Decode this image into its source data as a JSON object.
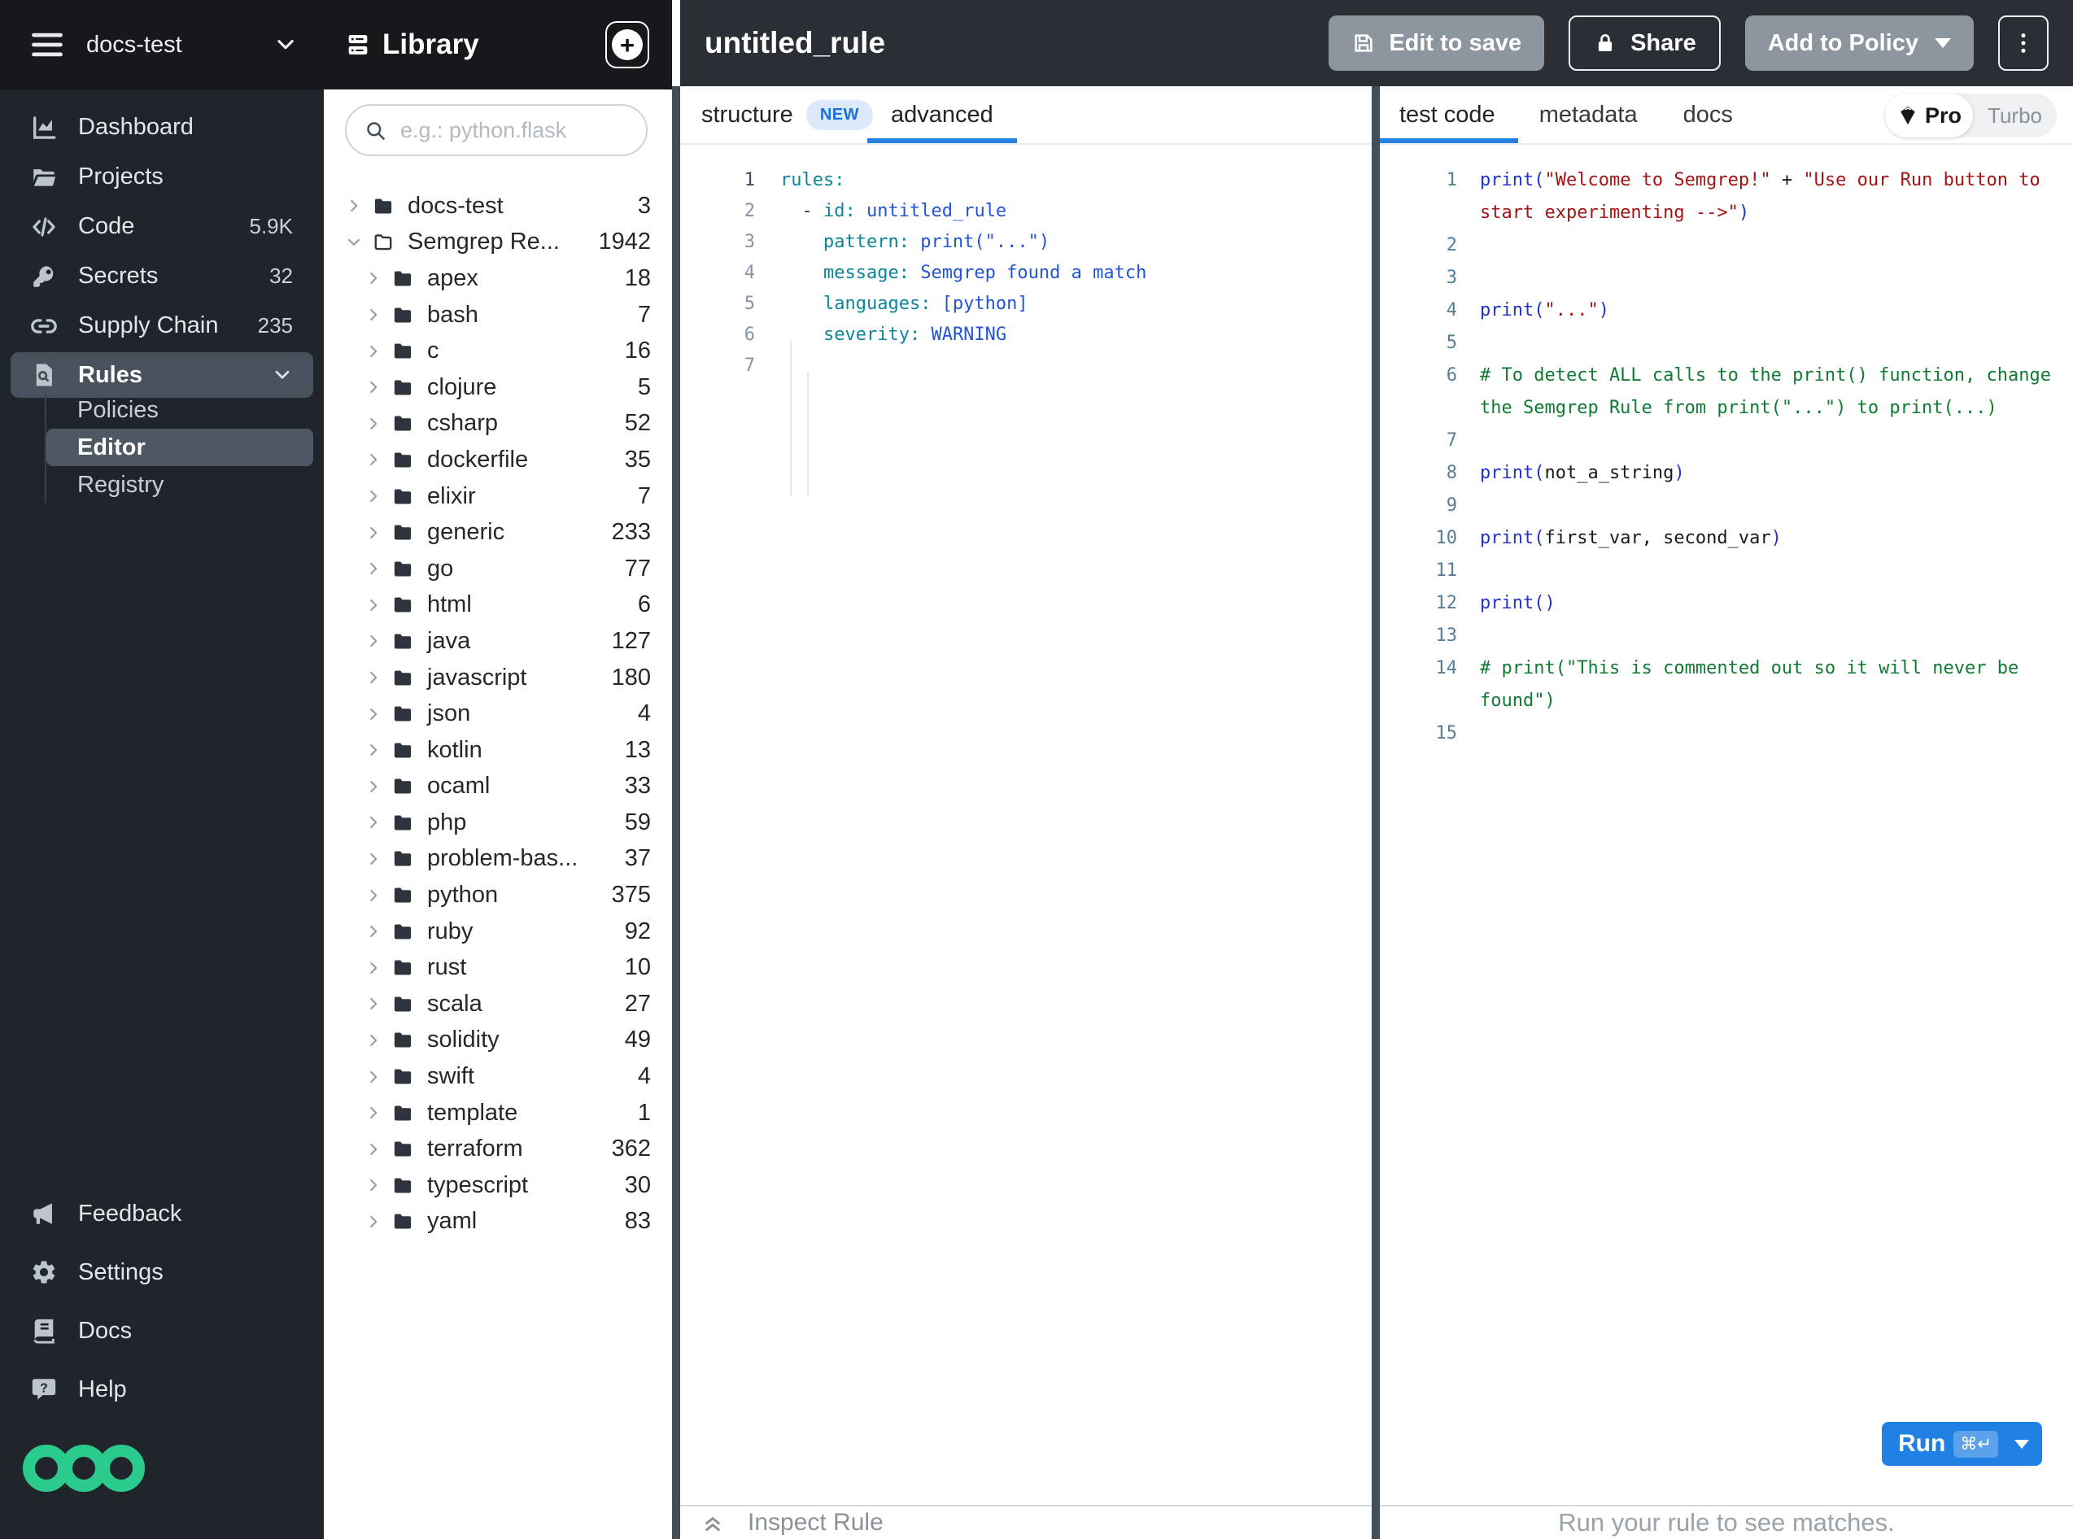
{
  "colors": {
    "brand_green": "#2bcb8e",
    "accent_blue": "#2581e2",
    "run_button_blue": "#2080e4",
    "topbar_bg": "#16181c",
    "sidebar_bg": "#20252b",
    "header_bg": "#2a2e35",
    "divider": "#424d57",
    "selected_row_bg": "#47525d",
    "new_badge_bg": "#dce9fb",
    "new_badge_text": "#1a6fde",
    "yaml_key": "#0c8599",
    "yaml_value": "#2454d6",
    "py_builtin": "#2433cc",
    "py_string": "#a31515",
    "py_comment": "#117a33"
  },
  "icons": {
    "hamburger": "menu-lines",
    "dashboard": "bar-chart",
    "projects": "open-folder",
    "code": "code-brackets-slash",
    "secrets": "key",
    "supply-chain": "chain-link",
    "rules": "document-magnifier",
    "feedback": "megaphone",
    "settings": "gear",
    "docs": "book",
    "help": "chat-question",
    "library": "collection-stack",
    "plus": "plus-circle",
    "search": "magnifier",
    "save": "floppy-disk",
    "lock": "padlock",
    "kebab": "vertical-dots",
    "chevron-down": "chevron-down",
    "chevron-right": "chevron-right",
    "double-chevron-up": "double-chevron-up",
    "pro-gem": "diamond",
    "folder-filled": "folder",
    "folder-outline": "folder-outline",
    "logo": "three-green-rings"
  },
  "topbar": {
    "org_name": "docs-test"
  },
  "sidebar": {
    "items": [
      {
        "label": "Dashboard",
        "icon": "dashboard"
      },
      {
        "label": "Projects",
        "icon": "projects"
      },
      {
        "label": "Code",
        "icon": "code",
        "badge": "5.9K"
      },
      {
        "label": "Secrets",
        "icon": "secrets",
        "badge": "32"
      },
      {
        "label": "Supply Chain",
        "icon": "supply-chain",
        "badge": "235"
      },
      {
        "label": "Rules",
        "icon": "rules",
        "selected": true,
        "expanded": true
      }
    ],
    "rules_children": [
      {
        "label": "Policies",
        "selected": false
      },
      {
        "label": "Editor",
        "selected": true
      },
      {
        "label": "Registry",
        "selected": false
      }
    ],
    "footer_items": [
      {
        "label": "Feedback",
        "icon": "feedback"
      },
      {
        "label": "Settings",
        "icon": "settings"
      },
      {
        "label": "Docs",
        "icon": "docs"
      },
      {
        "label": "Help",
        "icon": "help"
      }
    ]
  },
  "library": {
    "title": "Library",
    "search_placeholder": "e.g.: python.flask",
    "tree": [
      {
        "name": "docs-test",
        "count": "3",
        "depth": 0,
        "chevron": "right",
        "folder": "filled"
      },
      {
        "name": "Semgrep Re...",
        "count": "1942",
        "depth": 0,
        "chevron": "down",
        "folder": "outline"
      },
      {
        "name": "apex",
        "count": "18",
        "depth": 1,
        "chevron": "right",
        "folder": "filled"
      },
      {
        "name": "bash",
        "count": "7",
        "depth": 1,
        "chevron": "right",
        "folder": "filled"
      },
      {
        "name": "c",
        "count": "16",
        "depth": 1,
        "chevron": "right",
        "folder": "filled"
      },
      {
        "name": "clojure",
        "count": "5",
        "depth": 1,
        "chevron": "right",
        "folder": "filled"
      },
      {
        "name": "csharp",
        "count": "52",
        "depth": 1,
        "chevron": "right",
        "folder": "filled"
      },
      {
        "name": "dockerfile",
        "count": "35",
        "depth": 1,
        "chevron": "right",
        "folder": "filled"
      },
      {
        "name": "elixir",
        "count": "7",
        "depth": 1,
        "chevron": "right",
        "folder": "filled"
      },
      {
        "name": "generic",
        "count": "233",
        "depth": 1,
        "chevron": "right",
        "folder": "filled"
      },
      {
        "name": "go",
        "count": "77",
        "depth": 1,
        "chevron": "right",
        "folder": "filled"
      },
      {
        "name": "html",
        "count": "6",
        "depth": 1,
        "chevron": "right",
        "folder": "filled"
      },
      {
        "name": "java",
        "count": "127",
        "depth": 1,
        "chevron": "right",
        "folder": "filled"
      },
      {
        "name": "javascript",
        "count": "180",
        "depth": 1,
        "chevron": "right",
        "folder": "filled"
      },
      {
        "name": "json",
        "count": "4",
        "depth": 1,
        "chevron": "right",
        "folder": "filled"
      },
      {
        "name": "kotlin",
        "count": "13",
        "depth": 1,
        "chevron": "right",
        "folder": "filled"
      },
      {
        "name": "ocaml",
        "count": "33",
        "depth": 1,
        "chevron": "right",
        "folder": "filled"
      },
      {
        "name": "php",
        "count": "59",
        "depth": 1,
        "chevron": "right",
        "folder": "filled"
      },
      {
        "name": "problem-bas...",
        "count": "37",
        "depth": 1,
        "chevron": "right",
        "folder": "filled"
      },
      {
        "name": "python",
        "count": "375",
        "depth": 1,
        "chevron": "right",
        "folder": "filled"
      },
      {
        "name": "ruby",
        "count": "92",
        "depth": 1,
        "chevron": "right",
        "folder": "filled"
      },
      {
        "name": "rust",
        "count": "10",
        "depth": 1,
        "chevron": "right",
        "folder": "filled"
      },
      {
        "name": "scala",
        "count": "27",
        "depth": 1,
        "chevron": "right",
        "folder": "filled"
      },
      {
        "name": "solidity",
        "count": "49",
        "depth": 1,
        "chevron": "right",
        "folder": "filled"
      },
      {
        "name": "swift",
        "count": "4",
        "depth": 1,
        "chevron": "right",
        "folder": "filled"
      },
      {
        "name": "template",
        "count": "1",
        "depth": 1,
        "chevron": "right",
        "folder": "filled"
      },
      {
        "name": "terraform",
        "count": "362",
        "depth": 1,
        "chevron": "right",
        "folder": "filled"
      },
      {
        "name": "typescript",
        "count": "30",
        "depth": 1,
        "chevron": "right",
        "folder": "filled"
      },
      {
        "name": "yaml",
        "count": "83",
        "depth": 1,
        "chevron": "right",
        "folder": "filled"
      }
    ]
  },
  "header": {
    "title": "untitled_rule",
    "buttons": {
      "edit_to_save": "Edit to save",
      "share": "Share",
      "add_to_policy": "Add to Policy"
    }
  },
  "rule_panel": {
    "tabs": {
      "structure": "structure",
      "new_badge": "NEW",
      "advanced": "advanced"
    },
    "active_tab": "advanced",
    "code": [
      {
        "n": "1",
        "tokens": [
          [
            "rules:",
            "yk"
          ]
        ]
      },
      {
        "n": "2",
        "tokens": [
          [
            "  - ",
            "yp"
          ],
          [
            "id:",
            "yk"
          ],
          [
            " untitled_rule",
            "yv"
          ]
        ]
      },
      {
        "n": "3",
        "tokens": [
          [
            "    ",
            "yp"
          ],
          [
            "pattern:",
            "yk"
          ],
          [
            " print(\"...\")",
            "yv"
          ]
        ]
      },
      {
        "n": "4",
        "tokens": [
          [
            "    ",
            "yp"
          ],
          [
            "message:",
            "yk"
          ],
          [
            " Semgrep found a match",
            "yv"
          ]
        ]
      },
      {
        "n": "5",
        "tokens": [
          [
            "    ",
            "yp"
          ],
          [
            "languages:",
            "yk"
          ],
          [
            " [python]",
            "yv"
          ]
        ]
      },
      {
        "n": "6",
        "tokens": [
          [
            "    ",
            "yp"
          ],
          [
            "severity:",
            "yk"
          ],
          [
            " WARNING",
            "yv"
          ]
        ]
      },
      {
        "n": "7",
        "tokens": []
      }
    ],
    "inspect_label": "Inspect Rule"
  },
  "test_panel": {
    "tabs": {
      "test_code": "test code",
      "metadata": "metadata",
      "docs": "docs"
    },
    "active_tab": "test code",
    "pro_toggle": {
      "pro": "Pro",
      "turbo": "Turbo"
    },
    "code": [
      {
        "n": "1",
        "tokens": [
          [
            "print(",
            "pb"
          ],
          [
            "\"Welcome to Semgrep!\"",
            "ps"
          ],
          [
            " + ",
            "pp"
          ],
          [
            "\"Use our Run button to start experimenting -->\"",
            "ps"
          ],
          [
            ")",
            "pb"
          ]
        ]
      },
      {
        "n": "2",
        "tokens": []
      },
      {
        "n": "3",
        "tokens": []
      },
      {
        "n": "4",
        "tokens": [
          [
            "print(",
            "pb"
          ],
          [
            "\"...\"",
            "ps"
          ],
          [
            ")",
            "pb"
          ]
        ]
      },
      {
        "n": "5",
        "tokens": []
      },
      {
        "n": "6",
        "tokens": [
          [
            "# To detect ALL calls to the print() function, change the Semgrep Rule from print(\"...\") to print(...)",
            "pc"
          ]
        ]
      },
      {
        "n": "7",
        "tokens": []
      },
      {
        "n": "8",
        "tokens": [
          [
            "print(",
            "pb"
          ],
          [
            "not_a_string",
            "pp"
          ],
          [
            ")",
            "pb"
          ]
        ]
      },
      {
        "n": "9",
        "tokens": []
      },
      {
        "n": "10",
        "tokens": [
          [
            "print(",
            "pb"
          ],
          [
            "first_var, second_var",
            "pp"
          ],
          [
            ")",
            "pb"
          ]
        ]
      },
      {
        "n": "11",
        "tokens": []
      },
      {
        "n": "12",
        "tokens": [
          [
            "print()",
            "pb"
          ]
        ]
      },
      {
        "n": "13",
        "tokens": []
      },
      {
        "n": "14",
        "tokens": [
          [
            "# print(\"This is commented out so it will never be found\")",
            "pc"
          ]
        ]
      },
      {
        "n": "15",
        "tokens": []
      }
    ],
    "run_button": {
      "label": "Run",
      "shortcut": "⌘↵"
    },
    "status": "Run your rule to see matches."
  }
}
